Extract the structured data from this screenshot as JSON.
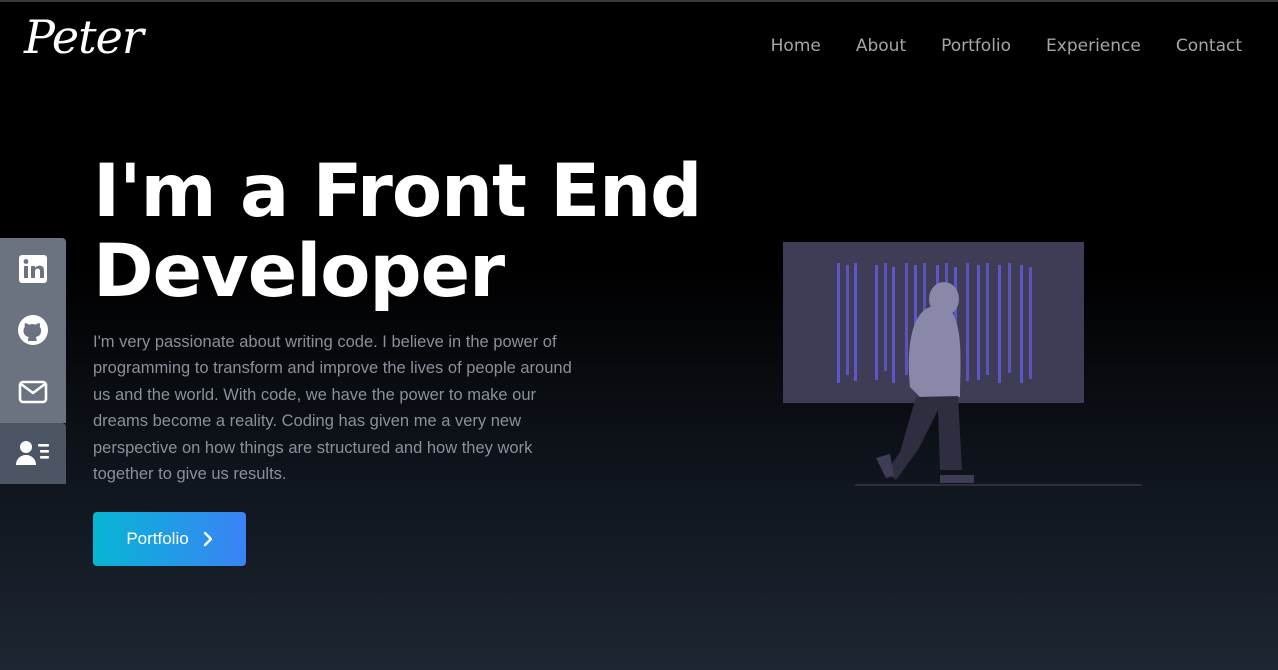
{
  "brand": {
    "logo": "Peter"
  },
  "nav": {
    "items": [
      {
        "label": "Home"
      },
      {
        "label": "About"
      },
      {
        "label": "Portfolio"
      },
      {
        "label": "Experience"
      },
      {
        "label": "Contact"
      }
    ]
  },
  "hero": {
    "title_line1": "I'm a Front End",
    "title_line2": "Developer",
    "text": "I'm very passionate about writing code. I believe in the power of programming to transform and improve the lives of people around us and the world. With code, we have the power to make our dreams become a reality. Coding has given me a very new perspective on how things are structured and how they work together to give us results.",
    "cta_label": "Portfolio"
  },
  "social": {
    "icons": [
      "linkedin-icon",
      "github-icon",
      "mail-icon",
      "resume-icon"
    ]
  },
  "colors": {
    "accent_start": "#06b6d4",
    "accent_end": "#3b82f6",
    "social_bg": "#6b7280",
    "nav_text": "#a6a6a6"
  }
}
